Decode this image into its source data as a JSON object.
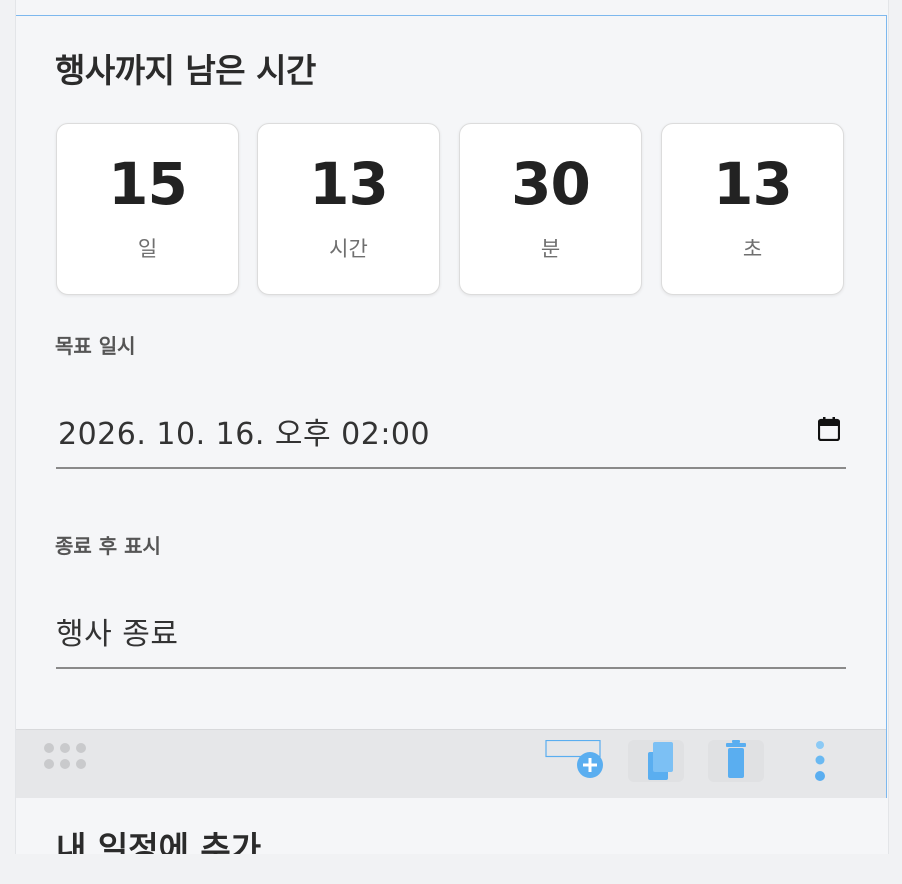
{
  "countdown": {
    "title": "행사까지 남은 시간",
    "days": {
      "value": "15",
      "unit": "일"
    },
    "hours": {
      "value": "13",
      "unit": "시간"
    },
    "minutes": {
      "value": "30",
      "unit": "분"
    },
    "seconds": {
      "value": "13",
      "unit": "초"
    }
  },
  "target_datetime": {
    "label": "목표 일시",
    "value": "2026. 10. 16. 오후 02:00"
  },
  "after_end": {
    "label": "종료 후 표시",
    "value": "행사 종료"
  },
  "next_section": {
    "title": "내 일정에 추가"
  },
  "colors": {
    "selection_border": "#7db8ee",
    "toolbar_icon": "#5aaef0"
  },
  "icons": {
    "calendar": "calendar-icon",
    "drag": "drag-handle-icon",
    "add": "add-block-icon",
    "copy": "copy-icon",
    "delete": "trash-icon",
    "more": "more-vertical-icon"
  }
}
